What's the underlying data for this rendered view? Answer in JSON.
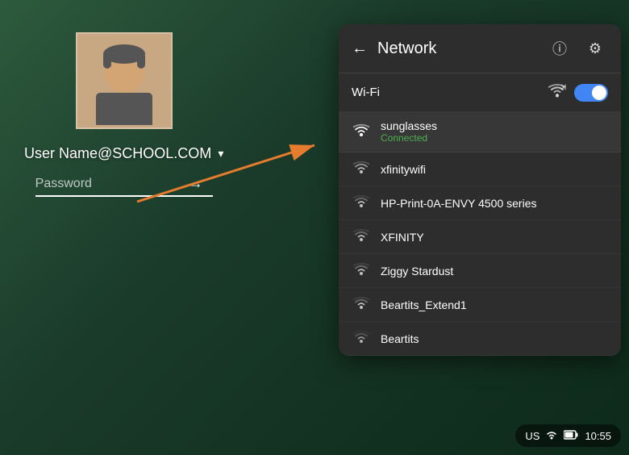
{
  "background": {
    "gradient_start": "#2d5a3d",
    "gradient_end": "#0d2a1a"
  },
  "login": {
    "username": "User Name@SCHOOL.COM",
    "password_placeholder": "Password",
    "arrow_btn_label": "→",
    "chevron_label": "▾"
  },
  "network_panel": {
    "title": "Network",
    "back_icon": "←",
    "info_icon": "ⓘ",
    "settings_icon": "⚙",
    "wifi_section_label": "Wi-Fi",
    "toggle_state": "on",
    "networks": [
      {
        "name": "sunglasses",
        "status": "Connected",
        "signal": 4,
        "connected": true
      },
      {
        "name": "xfinitywifi",
        "status": "",
        "signal": 3,
        "connected": false
      },
      {
        "name": "HP-Print-0A-ENVY 4500 series",
        "status": "",
        "signal": 2,
        "connected": false
      },
      {
        "name": "XFINITY",
        "status": "",
        "signal": 2,
        "connected": false
      },
      {
        "name": "Ziggy Stardust",
        "status": "",
        "signal": 2,
        "connected": false
      },
      {
        "name": "Beartits_Extend1",
        "status": "",
        "signal": 2,
        "connected": false
      },
      {
        "name": "Beartits",
        "status": "",
        "signal": 1,
        "connected": false
      }
    ]
  },
  "taskbar": {
    "locale": "US",
    "time": "10:55",
    "wifi_icon": "▲",
    "battery_icon": "🔋"
  }
}
